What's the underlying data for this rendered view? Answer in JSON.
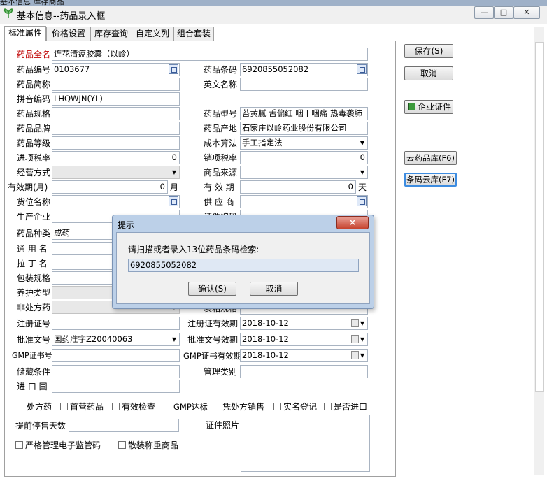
{
  "window": {
    "title": "基本信息--药品录入框",
    "top_strip_text": "基本信息 库存商品"
  },
  "tabs": [
    "标准属性",
    "价格设置",
    "库存查询",
    "自定义列",
    "组合套装"
  ],
  "form": {
    "full_name_label": "药品全名",
    "full_name_value": "连花清瘟胶囊（以岭）",
    "code_label": "药品编号",
    "code_value": "0103677",
    "barcode_label": "药品条码",
    "barcode_value": "6920855052082",
    "trade_name_label": "药品简称",
    "english_name_label": "英文名称",
    "pinyin_label": "拼音编码",
    "pinyin_value": "LHQWJN(YL)",
    "spec_label": "药品规格",
    "model_label": "药品型号",
    "model_value": "苔黄腻 舌偏红 咽干咽痛 热毒袭肺",
    "brand_label": "药品品牌",
    "origin_label": "药品产地",
    "origin_value": "石家庄以岭药业股份有限公司",
    "grade_label": "药品等级",
    "cost_label": "成本算法",
    "cost_value": "手工指定法",
    "in_tax_label": "进项税率",
    "in_tax_value": "0",
    "out_tax_label": "销项税率",
    "out_tax_value": "0",
    "biz_mode_label": "经营方式",
    "source_label": "商品来源",
    "expiry_months_label": "有效期(月)",
    "expiry_months_value": "0",
    "month_unit": "月",
    "expiry_days_label": "有 效 期",
    "expiry_days_value": "0",
    "day_unit": "天",
    "location_label": "货位名称",
    "supplier_label": "供 应 商",
    "manufacturer_label": "生产企业",
    "cert_no_label": "证件编码",
    "category_label": "药品种类",
    "category_value": "成药",
    "generic_label": "通 用 名",
    "latin_label": "拉 丁 名",
    "package_label": "包装规格",
    "care_label": "养护类型",
    "otc_label": "非处方药",
    "pack_spec_label": "装箱规格",
    "reg_no_label": "注册证号",
    "reg_expiry_label": "注册证有效期",
    "reg_expiry_value": "2018-10-12",
    "approval_label": "批准文号",
    "approval_value": "国药准字Z20040063",
    "approval_expiry_label": "批准文号效期",
    "approval_expiry_value": "2018-10-12",
    "gmp_label": "GMP证书号",
    "gmp_expiry_label": "GMP证书有效期",
    "gmp_expiry_value": "2018-10-12",
    "storage_label": "储藏条件",
    "mgmt_class_label": "管理类别",
    "import_country_label": "进 口 国",
    "checkboxes": [
      "处方药",
      "首营药品",
      "有效检查",
      "GMP达标",
      "凭处方销售",
      "实名登记",
      "是否进口"
    ],
    "stop_days_label": "提前停售天数",
    "cert_photo_label": "证件照片",
    "checkboxes2": [
      "严格管理电子监管码",
      "散装称重商品"
    ]
  },
  "buttons": {
    "save": "保存(S)",
    "cancel": "取消",
    "cert": "企业证件",
    "cloud_drug": "云药品库(F6)",
    "barcode_cloud": "条码云库(F7)"
  },
  "dialog": {
    "title": "提示",
    "prompt": "请扫描或者录入13位药品条码检索:",
    "input_value": "6920855052082",
    "ok": "确认(S)",
    "cancel": "取消",
    "close_icon": "×"
  }
}
